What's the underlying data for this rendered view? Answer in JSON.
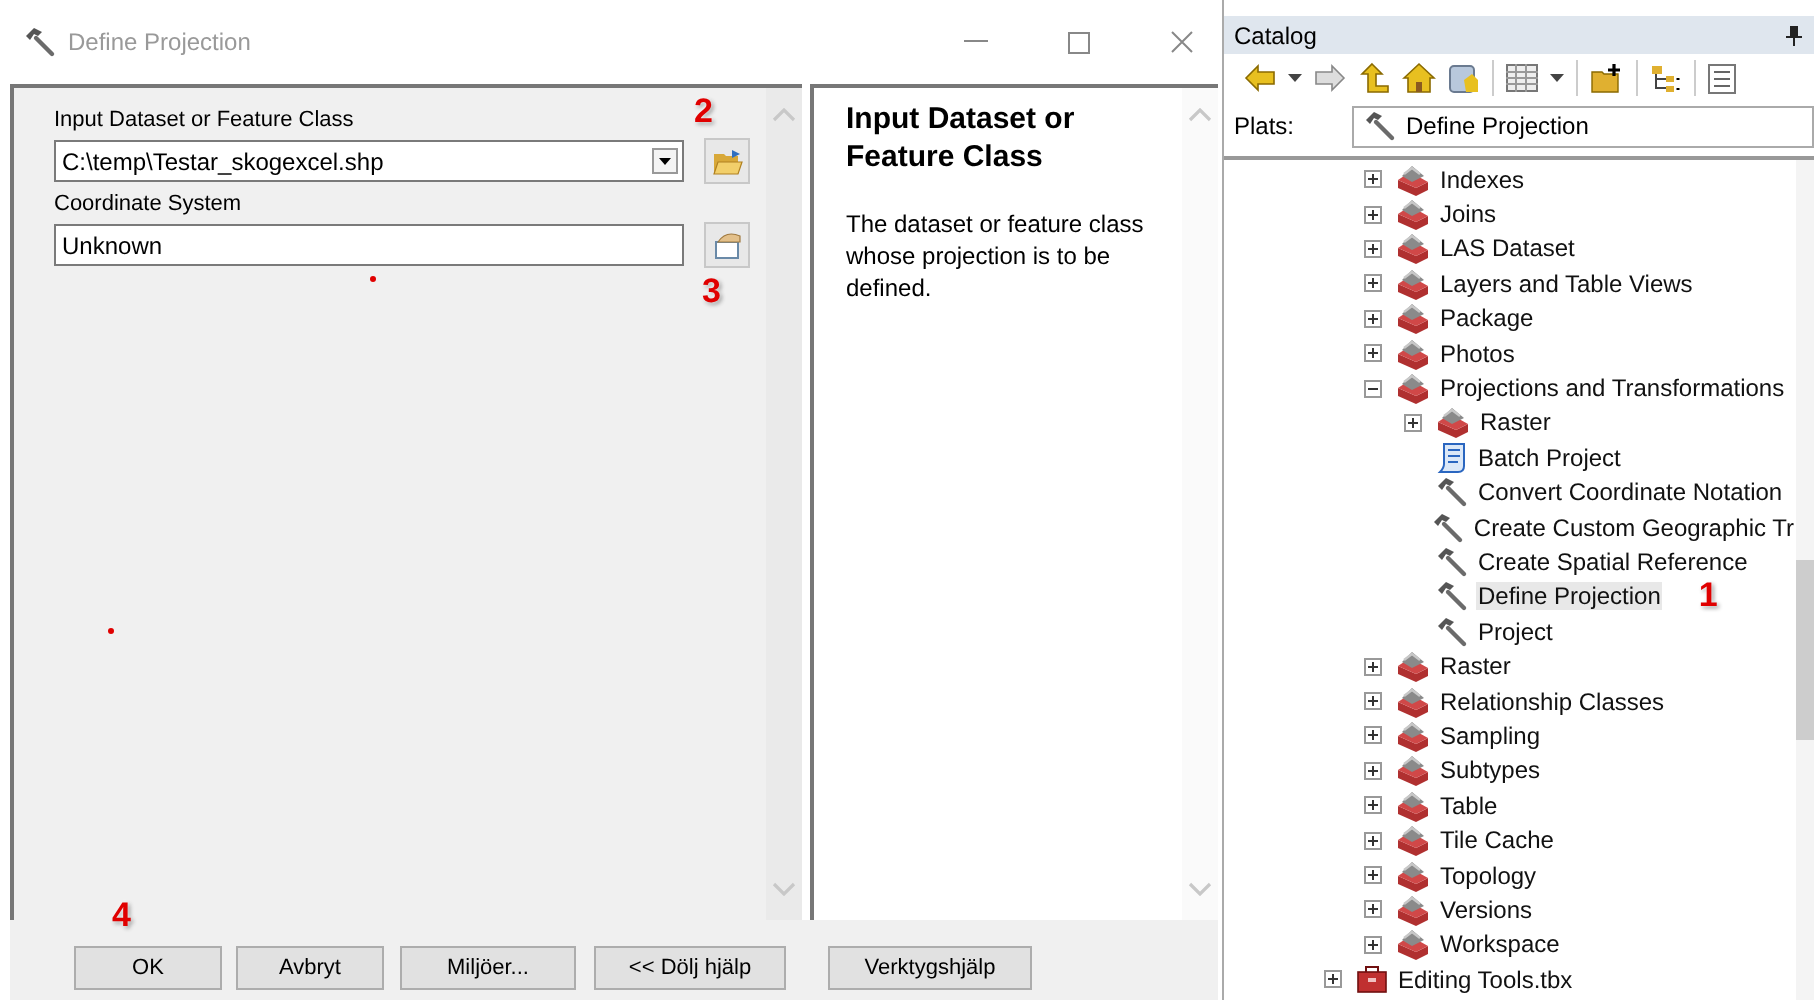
{
  "window": {
    "title": "Define Projection"
  },
  "form": {
    "fields": [
      {
        "label": "Input Dataset or Feature Class",
        "value": "C:\\temp\\Testar_skogexcel.shp",
        "kind": "dropdown",
        "callout": "2"
      },
      {
        "label": "Coordinate System",
        "value": "Unknown",
        "kind": "text",
        "callout": "3"
      }
    ]
  },
  "help": {
    "title": "Input Dataset or Feature Class",
    "text": "The dataset or feature class whose projection is to be defined."
  },
  "buttons": [
    {
      "label": "OK",
      "callout": "4"
    },
    {
      "label": "Avbryt"
    },
    {
      "label": "Miljöer..."
    },
    {
      "label": "<< Dölj hjälp"
    },
    {
      "label": "Verktygshjälp"
    }
  ],
  "catalog": {
    "title": "Catalog",
    "location_label": "Plats:",
    "location": "Define Projection",
    "tree": [
      {
        "kind": "hidden",
        "children": [
          {
            "label": "Indexes",
            "kind": "toolset",
            "expanded": false,
            "selected": false
          },
          {
            "label": "Joins",
            "kind": "toolset",
            "expanded": false,
            "selected": false
          },
          {
            "label": "LAS Dataset",
            "kind": "toolset",
            "expanded": false,
            "selected": false
          },
          {
            "label": "Layers and Table Views",
            "kind": "toolset",
            "expanded": false,
            "selected": false
          },
          {
            "label": "Package",
            "kind": "toolset",
            "expanded": false,
            "selected": false
          },
          {
            "label": "Photos",
            "kind": "toolset",
            "expanded": false,
            "selected": false
          },
          {
            "label": "Projections and Transformations",
            "kind": "toolset",
            "expanded": true,
            "selected": false,
            "children": [
              {
                "label": "Raster",
                "kind": "toolset",
                "expanded": false,
                "selected": false
              },
              {
                "label": "Batch Project",
                "kind": "script",
                "selected": false
              },
              {
                "label": "Convert Coordinate Notation",
                "kind": "tool",
                "selected": false
              },
              {
                "label": "Create Custom Geographic Tr",
                "kind": "tool",
                "selected": false
              },
              {
                "label": "Create Spatial Reference",
                "kind": "tool",
                "selected": false
              },
              {
                "label": "Define Projection",
                "kind": "tool",
                "selected": true,
                "callout": "1"
              },
              {
                "label": "Project",
                "kind": "tool",
                "selected": false
              }
            ]
          },
          {
            "label": "Raster",
            "kind": "toolset",
            "expanded": false,
            "selected": false
          },
          {
            "label": "Relationship Classes",
            "kind": "toolset",
            "expanded": false,
            "selected": false
          },
          {
            "label": "Sampling",
            "kind": "toolset",
            "expanded": false,
            "selected": false
          },
          {
            "label": "Subtypes",
            "kind": "toolset",
            "expanded": false,
            "selected": false
          },
          {
            "label": "Table",
            "kind": "toolset",
            "expanded": false,
            "selected": false
          },
          {
            "label": "Tile Cache",
            "kind": "toolset",
            "expanded": false,
            "selected": false
          },
          {
            "label": "Topology",
            "kind": "toolset",
            "expanded": false,
            "selected": false
          },
          {
            "label": "Versions",
            "kind": "toolset",
            "expanded": false,
            "selected": false
          },
          {
            "label": "Workspace",
            "kind": "toolset",
            "expanded": false,
            "selected": false
          }
        ]
      },
      {
        "label": "Editing Tools.tbx",
        "kind": "toolbox",
        "expanded": false,
        "selected": false
      }
    ]
  }
}
